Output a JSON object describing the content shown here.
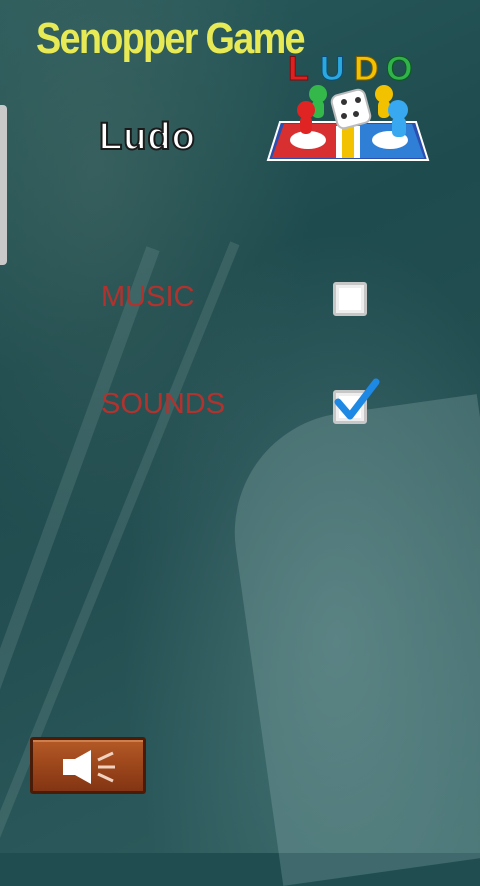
{
  "header": {
    "title": "Senopper Game",
    "subtitle": "Ludo"
  },
  "logo": {
    "letters": [
      "L",
      "U",
      "D",
      "O"
    ],
    "letter_colors": [
      "#e02020",
      "#2aa9e0",
      "#f2c200",
      "#2fb34a"
    ]
  },
  "settings": {
    "music": {
      "label": "MUSIC",
      "checked": false
    },
    "sounds": {
      "label": "SOUNDS",
      "checked": true
    }
  },
  "controls": {
    "sound_button_icon": "speaker-icon"
  },
  "colors": {
    "title": "#e7ea55",
    "label": "#b2322e",
    "check": "#1e88e5",
    "button": "#9a441a"
  }
}
